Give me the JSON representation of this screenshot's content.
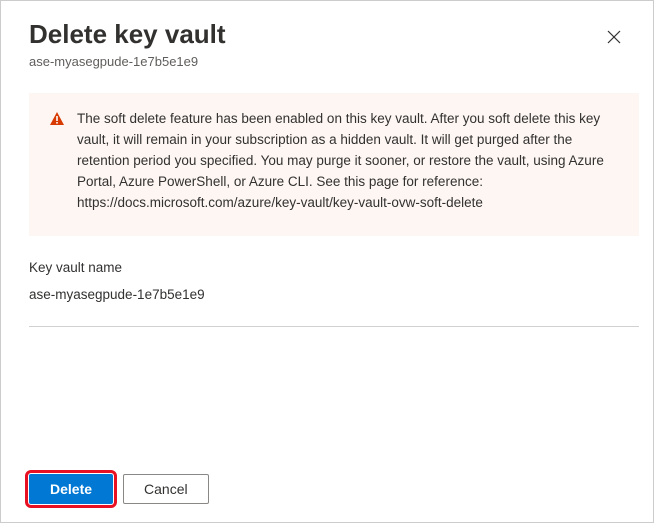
{
  "header": {
    "title": "Delete key vault",
    "subtitle": "ase-myasegpude-1e7b5e1e9"
  },
  "warning": {
    "message": "The soft delete feature has been enabled on this key vault. After you soft delete this key vault, it will remain in your subscription as a hidden vault. It will get purged after the retention period you specified. You may purge it sooner, or restore the vault, using Azure Portal, Azure PowerShell, or Azure CLI. See this page for reference: https://docs.microsoft.com/azure/key-vault/key-vault-ovw-soft-delete"
  },
  "field": {
    "label": "Key vault name",
    "value": "ase-myasegpude-1e7b5e1e9"
  },
  "footer": {
    "delete_label": "Delete",
    "cancel_label": "Cancel"
  },
  "colors": {
    "primary": "#0078d4",
    "warning_bg": "#fdf6f3",
    "warning_icon": "#d83b01",
    "highlight": "#e81123"
  }
}
